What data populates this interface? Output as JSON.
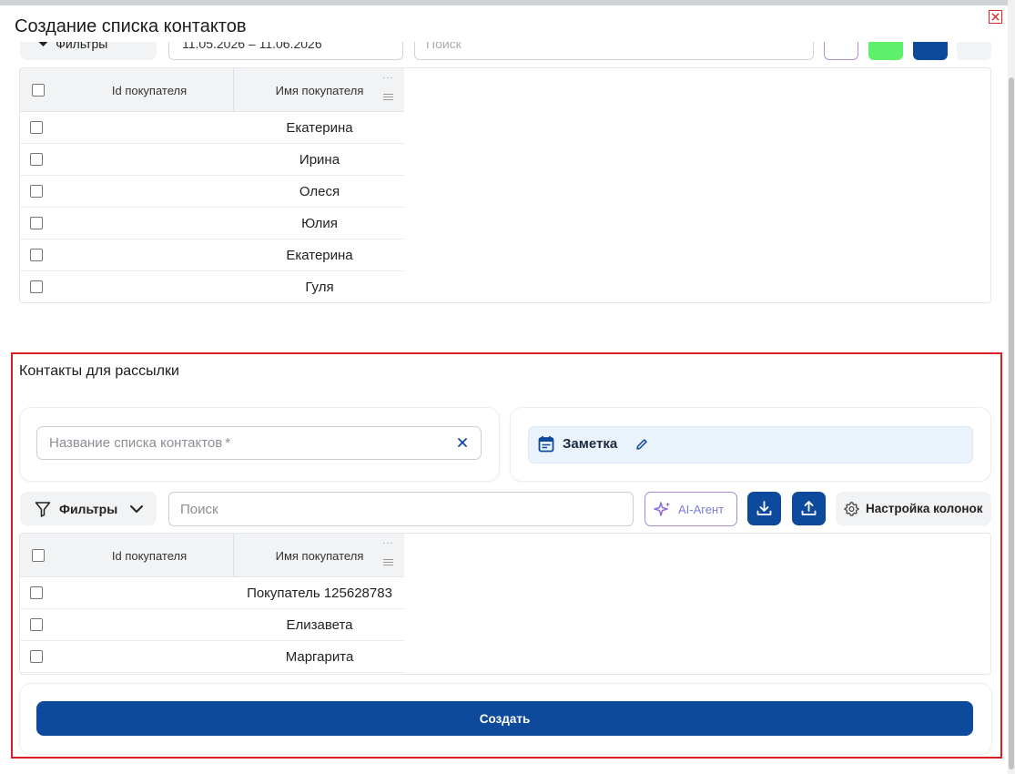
{
  "modal": {
    "title": "Создание списка контактов"
  },
  "top_toolbar": {
    "filter_label": "Фильтры",
    "date_range": "11.05.2026 – 11.06.2026",
    "search_placeholder": "Поиск"
  },
  "top_table": {
    "columns": [
      "Id покупателя",
      "Имя покупателя"
    ],
    "rows": [
      {
        "id": "",
        "name": "Екатерина"
      },
      {
        "id": "",
        "name": "Ирина"
      },
      {
        "id": "",
        "name": "Олеся"
      },
      {
        "id": "",
        "name": "Юлия"
      },
      {
        "id": "",
        "name": "Екатерина"
      },
      {
        "id": "",
        "name": "Гуля"
      }
    ]
  },
  "mailing": {
    "title": "Контакты для рассылки",
    "list_name_placeholder": "Название списка контактов",
    "required_mark": "*",
    "note_label": "Заметка",
    "filter_label": "Фильтры",
    "search_placeholder": "Поиск",
    "ai_label": "AI-Агент",
    "columns_settings_label": "Настройка колонок",
    "create_label": "Создать"
  },
  "bottom_table": {
    "columns": [
      "Id покупателя",
      "Имя покупателя"
    ],
    "rows": [
      {
        "id": "",
        "name": "Покупатель 125628783"
      },
      {
        "id": "",
        "name": "Елизавета"
      },
      {
        "id": "",
        "name": "Маргарита"
      }
    ]
  },
  "colors": {
    "primary": "#0e4a9b",
    "highlight_border": "#d91f26",
    "ai_border": "#a88ad2",
    "note_bg": "#eaf3fc"
  },
  "icons": {
    "close": "close-icon",
    "filter": "funnel-icon",
    "chevron": "chevron-down-icon",
    "clear": "clear-x-icon",
    "calendar": "calendar-icon",
    "edit": "pencil-icon",
    "ai": "sparkle-icon",
    "download": "download-icon",
    "upload": "upload-icon",
    "settings": "gear-icon"
  }
}
